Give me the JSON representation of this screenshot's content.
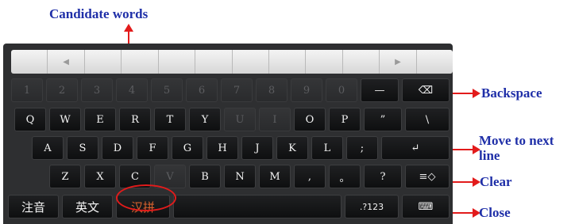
{
  "annotations": {
    "candidate_words": "Candidate words",
    "backspace": "Backspace",
    "move_to_next_line": [
      "Move to next",
      "line"
    ],
    "clear": "Clear",
    "close": "Close"
  },
  "candidate_bar": {
    "cells": [
      "",
      "◀",
      "",
      "",
      "",
      "",
      "",
      "",
      "",
      "",
      "▶",
      ""
    ]
  },
  "keyboard": {
    "row1": [
      "1",
      "2",
      "3",
      "4",
      "5",
      "6",
      "7",
      "8",
      "9",
      "0",
      "—",
      "⌫"
    ],
    "row2": [
      "Q",
      "W",
      "E",
      "R",
      "T",
      "Y",
      "U",
      "I",
      "O",
      "P",
      "”",
      "\\"
    ],
    "row3": [
      "A",
      "S",
      "D",
      "F",
      "G",
      "H",
      "J",
      "K",
      "L",
      ";",
      "↵"
    ],
    "row4": [
      "Z",
      "X",
      "C",
      "V",
      "B",
      "N",
      "M",
      ",",
      "。",
      "?",
      "≡◇"
    ],
    "row5": {
      "zhuyin": "注音",
      "english": "英文",
      "hanpin": "汉拼",
      "symbols": ".?123",
      "close": "⌨"
    }
  },
  "colors": {
    "annotation_text": "#1f2fa8",
    "arrow": "#e21b1b",
    "keyboard_bg": "#2e2f31",
    "active_mode": "#d8622e"
  }
}
